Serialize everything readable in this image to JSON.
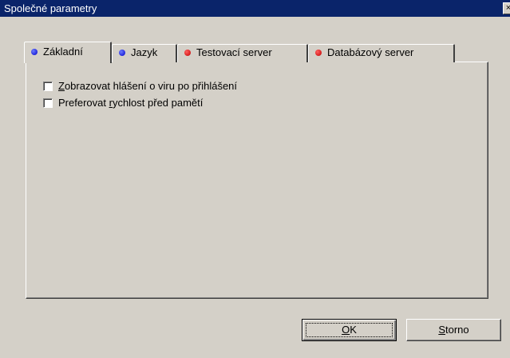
{
  "window": {
    "title": "Společné parametry",
    "close_glyph": "×"
  },
  "tabs": [
    {
      "label": "Základní",
      "dot_color": "#0000cc",
      "icon": "blue-dot-icon",
      "active": true
    },
    {
      "label": "Jazyk",
      "dot_color": "#0000cc",
      "icon": "blue-dot-icon",
      "active": false
    },
    {
      "label": "Testovací server",
      "dot_color": "#c00000",
      "icon": "red-dot-icon",
      "active": false
    },
    {
      "label": "Databázový server",
      "dot_color": "#c00000",
      "icon": "red-dot-icon",
      "active": false
    }
  ],
  "options": {
    "show_virus_report": {
      "accel": "Z",
      "rest": "obrazovat hlášení o viru po přihlášení",
      "checked": false
    },
    "prefer_speed": {
      "before": "Preferovat ",
      "accel": "r",
      "rest": "ychlost před pamětí",
      "checked": false
    }
  },
  "buttons": {
    "ok": {
      "accel": "O",
      "rest": "K"
    },
    "cancel": {
      "accel": "S",
      "rest": "torno"
    }
  }
}
